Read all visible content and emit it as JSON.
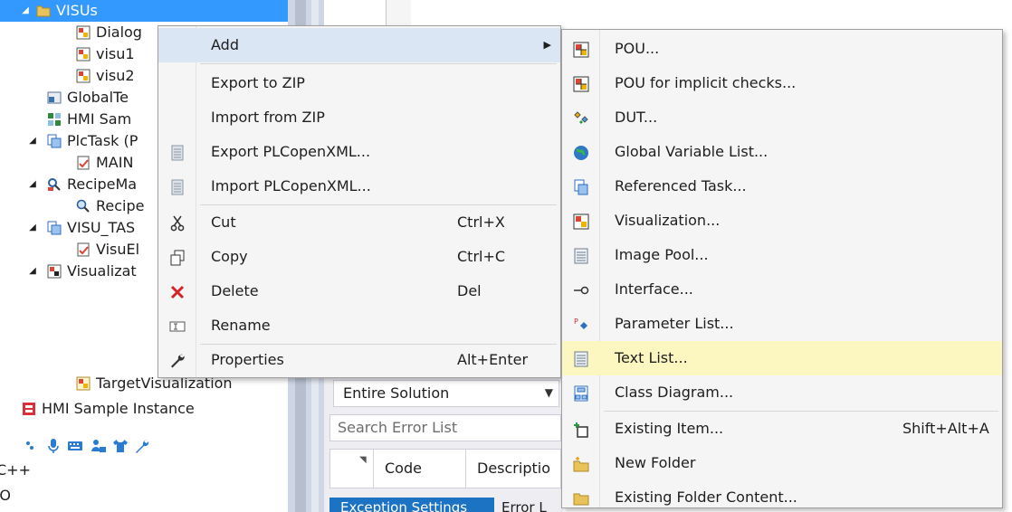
{
  "tree": {
    "rows": [
      {
        "label": "VISUs",
        "expander": "◢",
        "icon": "folder-icon"
      },
      {
        "label": "Dialog",
        "icon": "visualization-icon"
      },
      {
        "label": "visu1",
        "icon": "visualization-icon"
      },
      {
        "label": "visu2",
        "icon": "visualization-icon"
      },
      {
        "label": "GlobalTe",
        "icon": "global-text-list-icon"
      },
      {
        "label": "HMI Sam",
        "icon": "hmi-icon"
      },
      {
        "label": "PlcTask (P",
        "expander": "◢",
        "icon": "task-icon"
      },
      {
        "label": "MAIN",
        "icon": "program-icon"
      },
      {
        "label": "RecipeMa",
        "expander": "◢",
        "icon": "recipe-manager-icon"
      },
      {
        "label": "Recipe",
        "icon": "recipe-icon"
      },
      {
        "label": "VISU_TAS",
        "expander": "◢",
        "icon": "task-icon"
      },
      {
        "label": "VisuEl",
        "icon": "program-icon"
      },
      {
        "label": "Visualizat",
        "expander": "◢",
        "icon": "visualization-manager-icon"
      },
      {
        "label": "TargetVisualization",
        "icon": "target-visualization-icon"
      },
      {
        "label": "HMI Sample Instance",
        "icon": "device-icon"
      }
    ],
    "bottom_lines": [
      "C++",
      "/O"
    ]
  },
  "error_list": {
    "scope": "Entire Solution",
    "search_placeholder": "Search Error List",
    "col_code": "Code",
    "col_description": "Descriptio",
    "tab_exception": "Exception Settings",
    "tab_error": "Error L"
  },
  "context_menu": {
    "items": [
      {
        "label": "Add",
        "shortcut": "",
        "icon": ""
      },
      {
        "label": "Export to ZIP",
        "shortcut": "",
        "icon": ""
      },
      {
        "label": "Import from ZIP",
        "shortcut": "",
        "icon": ""
      },
      {
        "label": "Export PLCopenXML...",
        "shortcut": "",
        "icon": "export-xml-icon"
      },
      {
        "label": "Import PLCopenXML...",
        "shortcut": "",
        "icon": "import-xml-icon"
      },
      {
        "label": "Cut",
        "shortcut": "Ctrl+X",
        "icon": "scissors-icon"
      },
      {
        "label": "Copy",
        "shortcut": "Ctrl+C",
        "icon": "copy-icon"
      },
      {
        "label": "Delete",
        "shortcut": "Del",
        "icon": "delete-icon"
      },
      {
        "label": "Rename",
        "shortcut": "",
        "icon": "rename-icon"
      },
      {
        "label": "Properties",
        "shortcut": "Alt+Enter",
        "icon": "wrench-icon"
      }
    ]
  },
  "submenu": {
    "items": [
      {
        "label": "POU...",
        "shortcut": "",
        "icon": "pou-icon"
      },
      {
        "label": "POU for implicit checks...",
        "shortcut": "",
        "icon": "pou-checks-icon"
      },
      {
        "label": "DUT...",
        "shortcut": "",
        "icon": "dut-icon"
      },
      {
        "label": "Global Variable List...",
        "shortcut": "",
        "icon": "globe-icon"
      },
      {
        "label": "Referenced Task...",
        "shortcut": "",
        "icon": "referenced-task-icon"
      },
      {
        "label": "Visualization...",
        "shortcut": "",
        "icon": "visualization-icon"
      },
      {
        "label": "Image Pool...",
        "shortcut": "",
        "icon": "image-pool-icon"
      },
      {
        "label": "Interface...",
        "shortcut": "",
        "icon": "interface-icon"
      },
      {
        "label": "Parameter List...",
        "shortcut": "",
        "icon": "parameter-list-icon"
      },
      {
        "label": "Text List...",
        "shortcut": "",
        "icon": "text-list-icon"
      },
      {
        "label": "Class Diagram...",
        "shortcut": "",
        "icon": "class-diagram-icon"
      },
      {
        "label": "Existing Item...",
        "shortcut": "Shift+Alt+A",
        "icon": "existing-item-icon"
      },
      {
        "label": "New Folder",
        "shortcut": "",
        "icon": "new-folder-icon"
      },
      {
        "label": "Existing Folder Content...",
        "shortcut": "",
        "icon": "folder-icon"
      }
    ]
  },
  "colors": {
    "selection": "#3399ff",
    "menu_bg": "#f5f5f5",
    "menu_highlight": "#fcf6c0",
    "open_item": "#dbe6f5"
  }
}
